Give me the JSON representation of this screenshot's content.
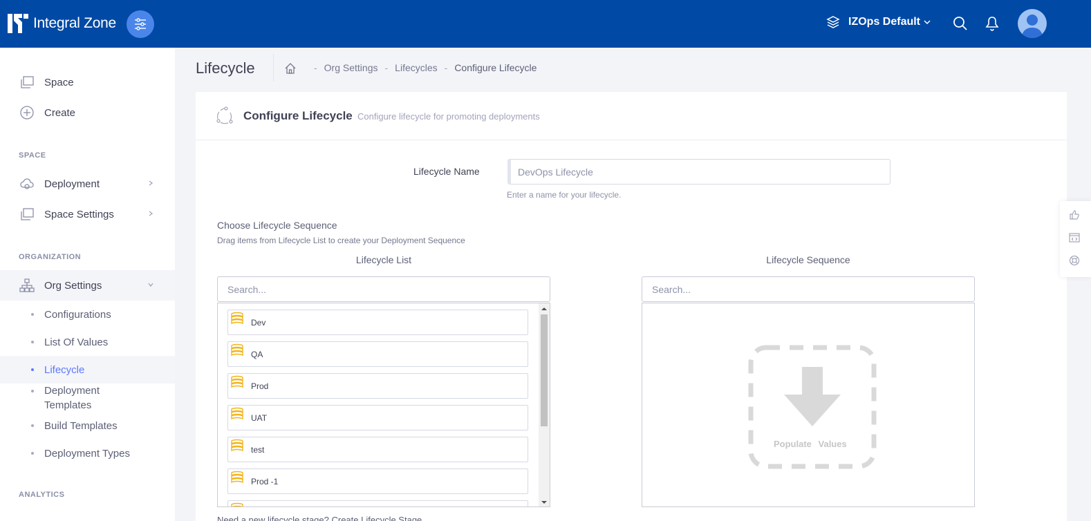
{
  "header": {
    "brand": "Integral Zone",
    "space_name": "IZOps Default"
  },
  "sidebar": {
    "top_items": [
      {
        "label": "Space"
      },
      {
        "label": "Create"
      }
    ],
    "space_label": "SPACE",
    "space_items": [
      {
        "label": "Deployment"
      },
      {
        "label": "Space Settings"
      }
    ],
    "org_label": "ORGANIZATION",
    "org_settings": "Org Settings",
    "org_children": [
      {
        "label": "Configurations"
      },
      {
        "label": "List Of Values"
      },
      {
        "label": "Lifecycle"
      },
      {
        "label": "Deployment Templates"
      },
      {
        "label": "Build Templates"
      },
      {
        "label": "Deployment Types"
      }
    ],
    "analytics_label": "ANALYTICS"
  },
  "subheader": {
    "title": "Lifecycle",
    "breadcrumbs": [
      "Org Settings",
      "Lifecycles",
      "Configure Lifecycle"
    ],
    "sep": "-"
  },
  "card": {
    "title": "Configure Lifecycle",
    "subtitle": "Configure lifecycle for promoting deployments",
    "name_label": "Lifecycle Name",
    "name_placeholder": "DevOps Lifecycle",
    "name_hint": "Enter a name for your lifecycle.",
    "choose_title": "Choose Lifecycle Sequence",
    "choose_sub": "Drag items from Lifecycle List to create your Deployment Sequence",
    "list_title": "Lifecycle List",
    "seq_title": "Lifecycle Sequence",
    "search_placeholder": "Search...",
    "list_items": [
      "Dev",
      "QA",
      "Prod",
      "UAT",
      "test",
      "Prod -1"
    ],
    "drop_label": "Populate Values",
    "bottom_text": "Need a new lifecycle stage? Create Lifecycle Stage"
  },
  "colors": {
    "header_bg": "#0049a5",
    "accent": "#5d78ff",
    "stage_icon": "#f2b51c"
  }
}
